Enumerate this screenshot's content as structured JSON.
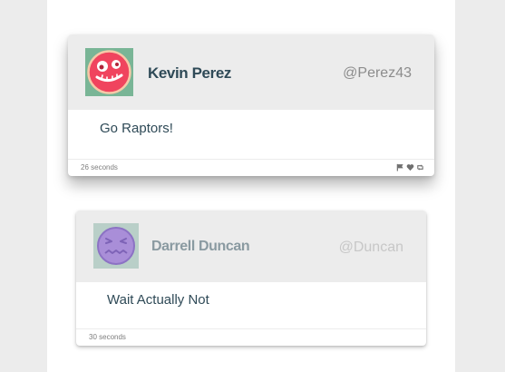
{
  "tweets": [
    {
      "name": "Kevin Perez",
      "handle": "@Perez43",
      "message": "Go Raptors!",
      "time": "26 seconds",
      "avatar_icon": "zany-face-icon",
      "avatar_bg": "#79b596",
      "avatar_color": "#f0445e"
    },
    {
      "name": "Darrell Duncan",
      "handle": "@Duncan",
      "message": "Wait Actually Not",
      "time": "30 seconds",
      "avatar_icon": "grimace-face-icon",
      "avatar_bg": "#b9cfc8",
      "avatar_color": "#a98ed8"
    }
  ],
  "actions": {
    "icons": [
      "flag-icon",
      "heart-icon",
      "retweet-icon"
    ],
    "color": "#6f6f6f"
  }
}
